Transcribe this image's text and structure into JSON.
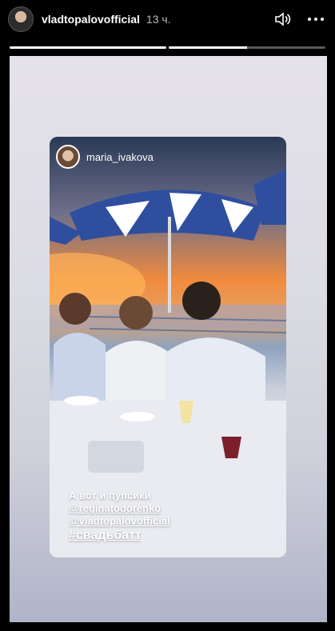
{
  "header": {
    "username": "vladtopalovofficial",
    "time": "13 ч."
  },
  "progress": [
    1.0,
    0.5
  ],
  "repost": {
    "author": "maria_ivakova",
    "caption": "А вот и пупсики",
    "mentions": [
      "@reginatodorenko",
      "@vladtopalovofficial"
    ],
    "hashtag": "#свадьбатт"
  },
  "icons": {
    "volume": "volume-icon",
    "more": "more-options-icon"
  }
}
